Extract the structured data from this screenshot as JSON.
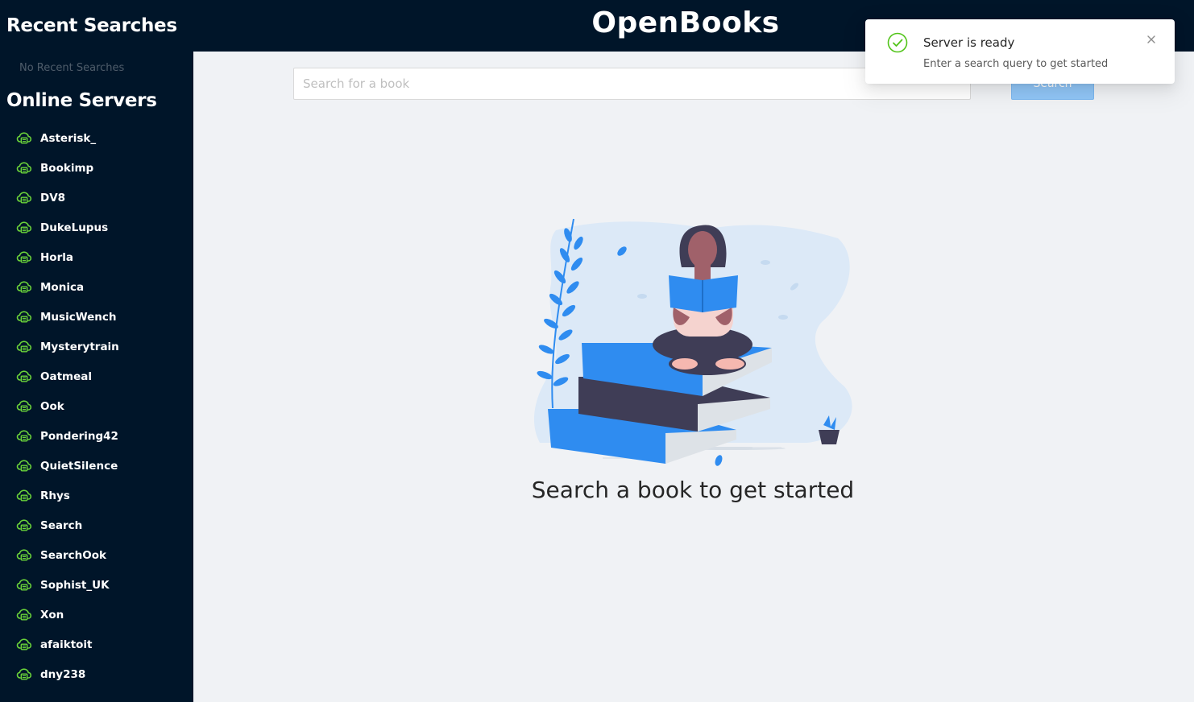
{
  "header": {
    "title": "OpenBooks"
  },
  "sidebar": {
    "recent_title": "Recent Searches",
    "no_recent": "No Recent Searches",
    "online_title": "Online Servers",
    "servers": [
      "Asterisk_",
      "Bookimp",
      "DV8",
      "DukeLupus",
      "Horla",
      "Monica",
      "MusicWench",
      "Mysterytrain",
      "Oatmeal",
      "Ook",
      "Pondering42",
      "QuietSilence",
      "Rhys",
      "Search",
      "SearchOok",
      "Sophist_UK",
      "Xon",
      "afaiktoit",
      "dny238"
    ],
    "server_icon": "cloud-server-icon",
    "icon_color": "#6ad33a"
  },
  "search": {
    "placeholder": "Search for a book",
    "value": "",
    "button_label": "Search"
  },
  "main": {
    "empty_message": "Search a book to get started"
  },
  "notification": {
    "title": "Server is ready",
    "description": "Enter a search query to get started",
    "icon": "check-circle-icon",
    "close_icon": "close-icon"
  },
  "colors": {
    "nav_bg": "#001529",
    "accent": "#1890ff",
    "success": "#52c41a"
  }
}
